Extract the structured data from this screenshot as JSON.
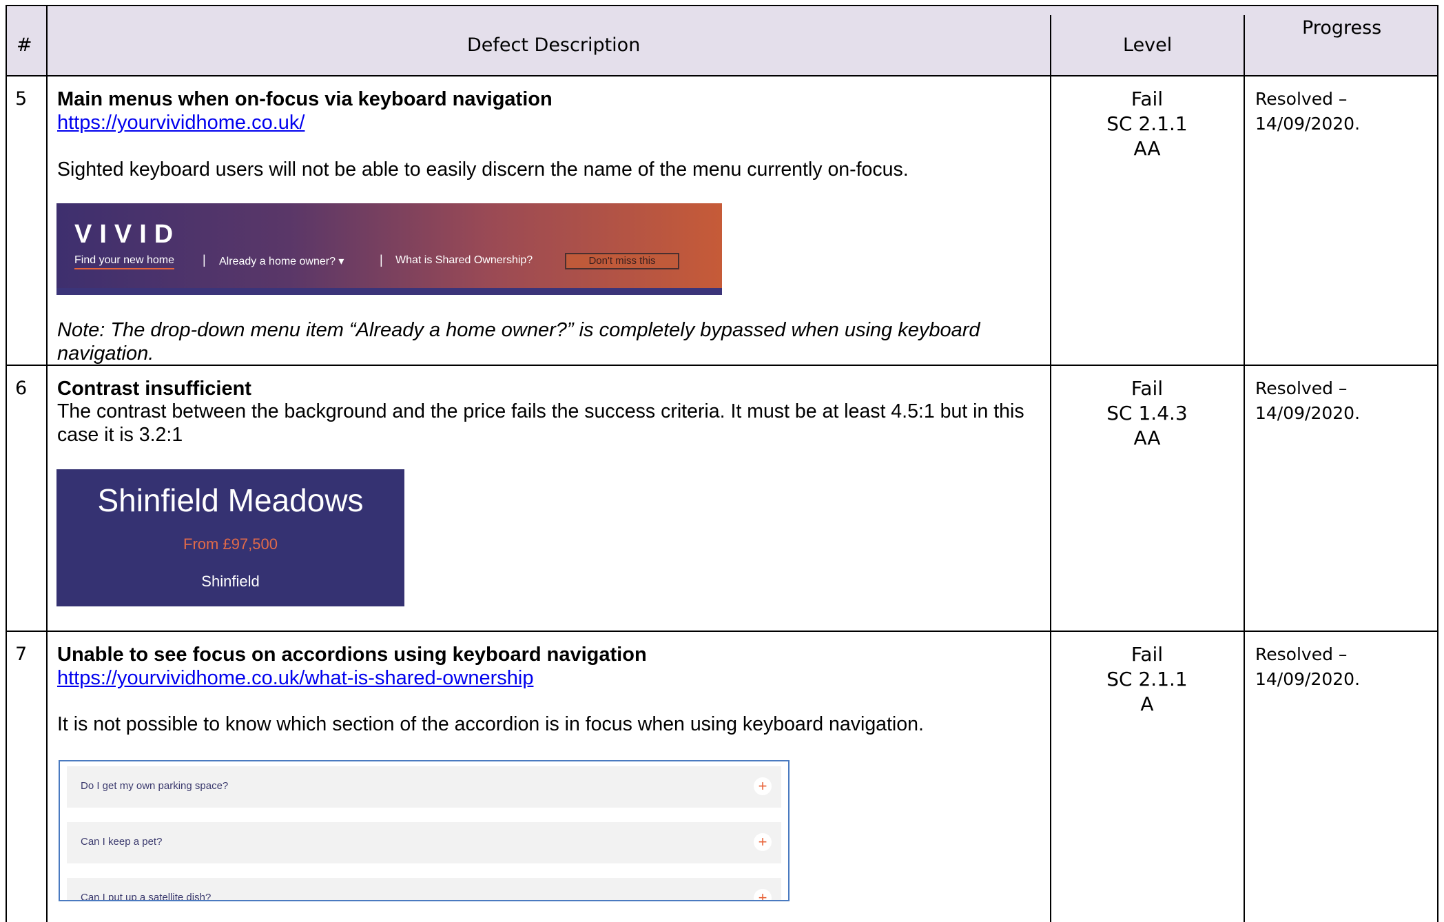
{
  "table": {
    "headers": {
      "number": "#",
      "description": "Defect Description",
      "level": "Level",
      "progress": "Progress"
    },
    "rows": [
      {
        "number": "5",
        "title": "Main menus when on-focus via keyboard navigation",
        "link": "https://yourvividhome.co.uk/",
        "description": "Sighted keyboard users will not be able to easily discern the name of the menu currently on-focus.",
        "note": "Note: The drop-down menu item “Already a home owner?” is completely bypassed when using keyboard navigation.",
        "level": {
          "result": "Fail",
          "criterion": "SC 2.1.1",
          "conformance": "AA"
        },
        "progress": {
          "status": "Resolved –",
          "date": "14/09/2020."
        },
        "screenshot": {
          "logo": "VIVID",
          "nav_items": [
            "Find your new home",
            "Already a home owner? ▾",
            "What is Shared Ownership?"
          ],
          "separator": "|",
          "button": "Don't miss this"
        }
      },
      {
        "number": "6",
        "title": "Contrast insufficient",
        "description": "The contrast between the background and the price fails the success criteria. It must be at least 4.5:1 but in this case it is 3.2:1",
        "level": {
          "result": "Fail",
          "criterion": "SC 1.4.3",
          "conformance": "AA"
        },
        "progress": {
          "status": "Resolved –",
          "date": "14/09/2020."
        },
        "screenshot": {
          "name": "Shinfield Meadows",
          "price": "From £97,500",
          "location": "Shinfield"
        }
      },
      {
        "number": "7",
        "title": "Unable to see focus on accordions using keyboard navigation",
        "link": "https://yourvividhome.co.uk/what-is-shared-ownership",
        "description": "It is not possible to know which section of the accordion is in focus when using keyboard navigation.",
        "level": {
          "result": "Fail",
          "criterion": "SC 2.1.1",
          "conformance": "A"
        },
        "progress": {
          "status": "Resolved –",
          "date": "14/09/2020."
        },
        "screenshot": {
          "questions": [
            "Do I get my own parking space?",
            "Can I keep a pet?",
            "Can I put up a satellite dish?"
          ],
          "expand_symbol": "+"
        }
      }
    ]
  },
  "colors": {
    "header_bg": "#e4dfeb",
    "link": "#0000ee",
    "vivid_purple": "#3e2f6e",
    "vivid_orange": "#c65b38",
    "shinfield_bg": "#353272",
    "price_orange": "#e16a49",
    "accordion_border": "#4a7ac0"
  }
}
